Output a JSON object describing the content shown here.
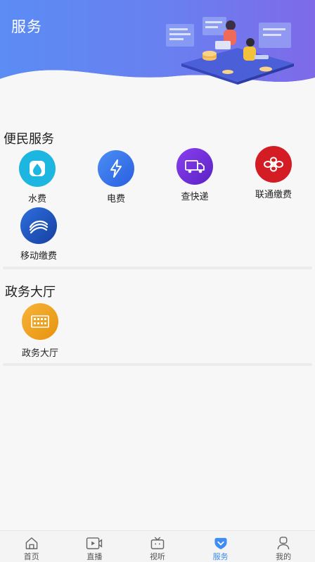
{
  "page": {
    "title": "服务"
  },
  "sections": [
    {
      "title": "便民服务",
      "items": [
        {
          "label": "水费",
          "icon": "water-drop-icon",
          "color": "#1db6e0"
        },
        {
          "label": "电费",
          "icon": "lightning-icon",
          "color": "#2f6ee6"
        },
        {
          "label": "查快递",
          "icon": "delivery-truck-icon",
          "color": "#6a2fd6"
        },
        {
          "label": "联通缴费",
          "icon": "china-unicom-logo-icon",
          "color": "#d41c25"
        },
        {
          "label": "移动缴费",
          "icon": "china-mobile-logo-icon",
          "color": "#1a4fb8"
        }
      ]
    },
    {
      "title": "政务大厅",
      "items": [
        {
          "label": "政务大厅",
          "icon": "government-hall-icon",
          "color": "#f0a01e"
        }
      ]
    }
  ],
  "tabbar": {
    "active_color": "#3e8df4",
    "items": [
      {
        "label": "首页",
        "icon": "home-icon"
      },
      {
        "label": "直播",
        "icon": "live-video-icon"
      },
      {
        "label": "视听",
        "icon": "tv-icon"
      },
      {
        "label": "服务",
        "icon": "service-icon",
        "active": true
      },
      {
        "label": "我的",
        "icon": "user-icon"
      }
    ]
  }
}
